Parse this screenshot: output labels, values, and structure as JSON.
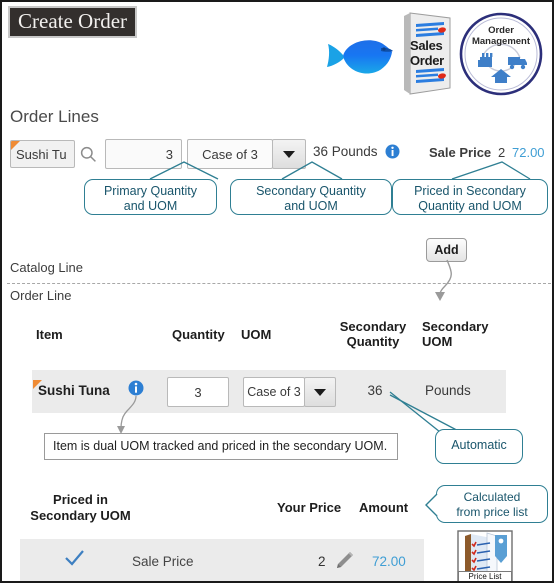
{
  "window": {
    "title": "Create Order"
  },
  "artwork": {
    "fish_icon": "fish-icon",
    "sales_order_doc": {
      "line1": "Sales",
      "line2": "Order",
      "icon": "sales-order-document-icon"
    },
    "order_management_badge": {
      "line1": "Order",
      "line2": "Management",
      "icon": "order-management-cycle-icon"
    }
  },
  "section": {
    "heading": "Order Lines"
  },
  "catalog_row": {
    "item_value": "Sushi Tu",
    "search_icon": "search-icon",
    "quantity": "3",
    "uom": "Case of 3",
    "dropdown_icon": "chevron-down-icon",
    "secondary": "36 Pounds",
    "info_icon": "info-icon",
    "sale_price_label": "Sale Price",
    "sale_price_qty": "2",
    "sale_price_amount": "72.00"
  },
  "callouts": {
    "primary": "Primary Quantity and UOM",
    "primary_line1": "Primary Quantity",
    "primary_line2": "and UOM",
    "secondary_line1": "Secondary Quantity",
    "secondary_line2": "and UOM",
    "priced_line1": "Priced in Secondary",
    "priced_line2": "Quantity and UOM",
    "automatic": "Automatic",
    "calculated_line1": "Calculated",
    "calculated_line2": "from price list"
  },
  "separator": {
    "catalog_line_label": "Catalog Line",
    "order_line_label": "Order  Line",
    "add_button_label": "Add"
  },
  "order_table": {
    "headers": {
      "item": "Item",
      "quantity": "Quantity",
      "uom": "UOM",
      "secondary_quantity_line1": "Secondary",
      "secondary_quantity_line2": "Quantity",
      "secondary_uom_line1": "Secondary",
      "secondary_uom_line2": "UOM"
    },
    "row": {
      "item": "Sushi Tuna",
      "info_icon": "info-icon",
      "quantity": "3",
      "uom": "Case of 3",
      "dropdown_icon": "chevron-down-icon",
      "secondary_quantity": "36",
      "secondary_uom": "Pounds"
    }
  },
  "tooltip": {
    "text": "Item is dual UOM tracked and priced in the secondary UOM."
  },
  "price_table": {
    "headers": {
      "priced_in_line1": "Priced in",
      "priced_in_line2": "Secondary UOM",
      "your_price": "Your Price",
      "amount": "Amount"
    },
    "row": {
      "check_icon": "check-icon",
      "label": "Sale Price",
      "your_price": "2",
      "edit_icon": "pencil-icon",
      "amount": "72.00"
    }
  },
  "price_list_icon": {
    "label": "Price List",
    "icon": "price-list-icon"
  },
  "colors": {
    "accent_blue": "#3f9ed4",
    "callout_border": "#2f7f93",
    "required_marker": "#ef8b35",
    "row_background": "#ebebeb",
    "title_background": "#332f2d"
  }
}
